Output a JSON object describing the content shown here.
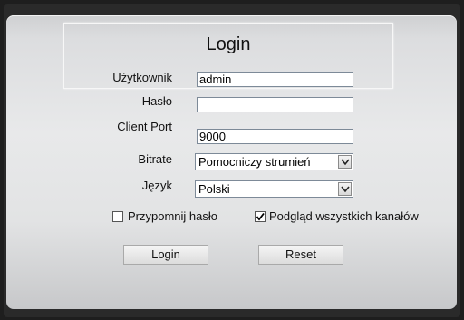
{
  "login_form": {
    "title": "Login",
    "username": {
      "label": "Użytkownik",
      "value": "admin"
    },
    "password": {
      "label": "Hasło",
      "value": ""
    },
    "client_port": {
      "label": "Client Port",
      "value": "9000"
    },
    "bitrate": {
      "label": "Bitrate",
      "selected": "Pomocniczy strumień"
    },
    "language": {
      "label": "Język",
      "selected": "Polski"
    },
    "remember_password": {
      "label": "Przypomnij hasło",
      "checked": false
    },
    "preview_all_channels": {
      "label": "Podgląd wszystkich kanałów",
      "checked": true
    },
    "login_button": "Login",
    "reset_button": "Reset"
  }
}
